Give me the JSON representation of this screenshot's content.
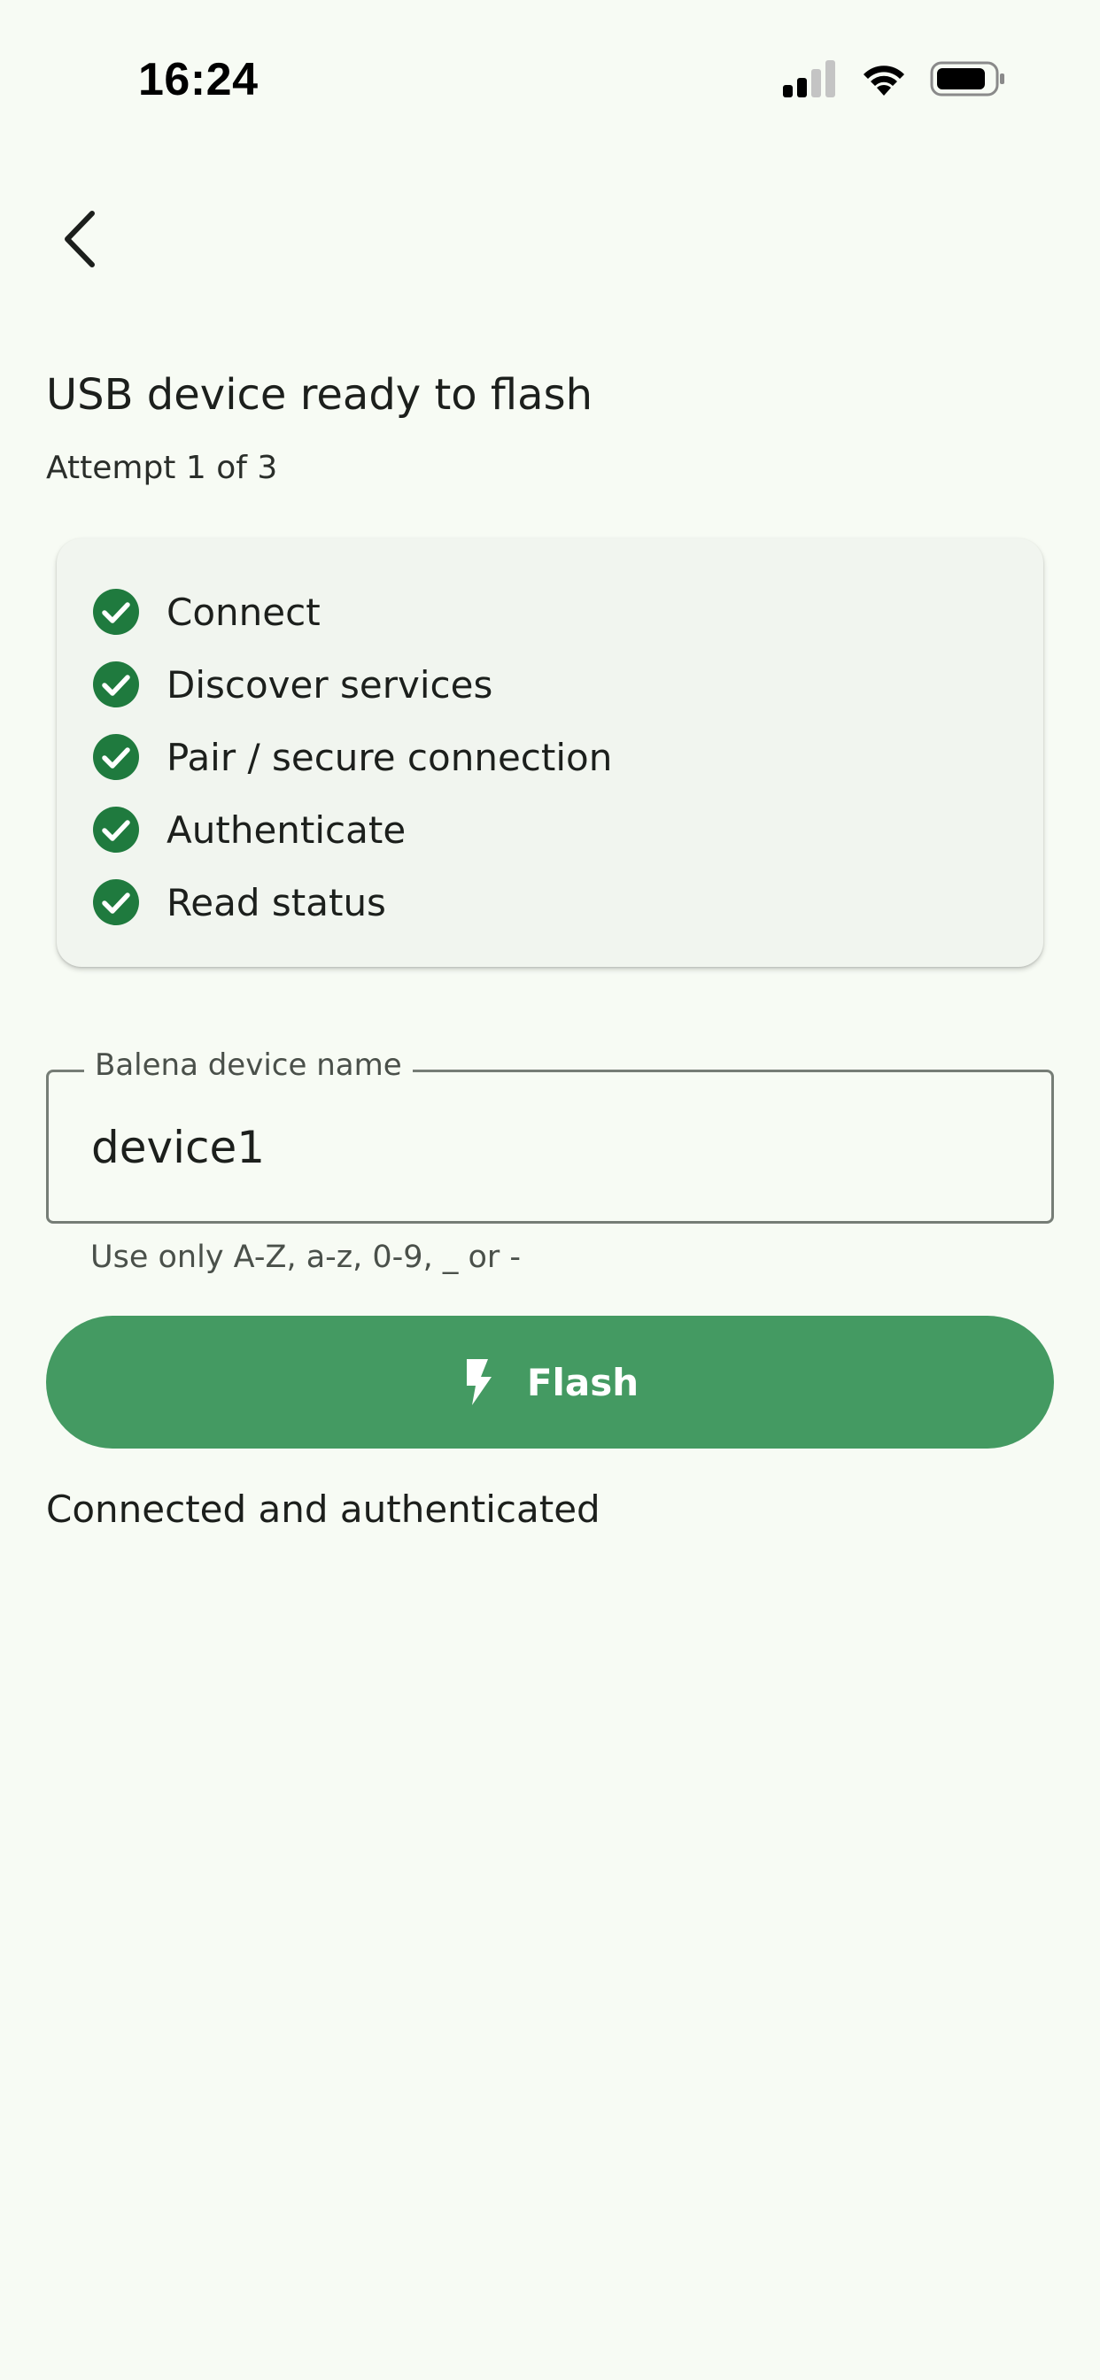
{
  "status_bar": {
    "time": "16:24"
  },
  "header": {
    "back_icon": "chevron-left-icon"
  },
  "page": {
    "title": "USB device ready to flash",
    "attempt": "Attempt 1 of 3"
  },
  "steps": [
    {
      "label": "Connect",
      "status": "done"
    },
    {
      "label": "Discover services",
      "status": "done"
    },
    {
      "label": "Pair / secure connection",
      "status": "done"
    },
    {
      "label": "Authenticate",
      "status": "done"
    },
    {
      "label": "Read status",
      "status": "done"
    }
  ],
  "device_name_field": {
    "label": "Balena device name",
    "value": "device1",
    "helper": "Use only A-Z, a-z, 0-9, _ or -"
  },
  "flash_button": {
    "label": "Flash",
    "icon": "lightning-bolt-icon"
  },
  "status_message": "Connected and authenticated",
  "colors": {
    "background": "#f7fbf4",
    "accent": "#449a62",
    "check": "#1f7a3e",
    "card": "#f1f5ef"
  }
}
